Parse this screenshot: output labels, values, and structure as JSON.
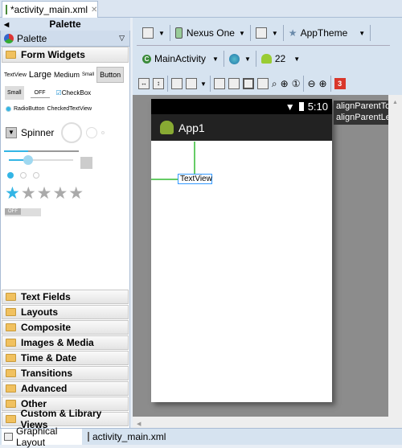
{
  "editor_tab": {
    "title": "*activity_main.xml",
    "close_icon": "close-icon"
  },
  "palette": {
    "header": "Palette",
    "title": "Palette",
    "open_category": "Form Widgets",
    "widgets": {
      "textview": "TextView",
      "large": "Large",
      "medium": "Medium",
      "small": "Small",
      "button": "Button",
      "small_button": "Small",
      "toggle": "OFF",
      "checkbox": "CheckBox",
      "radio": "RadioButton",
      "checked_text": "CheckedTextView",
      "spinner": "Spinner",
      "switch": "OFF"
    },
    "rating_stars": 5,
    "rating_value": 1,
    "categories": [
      "Text Fields",
      "Layouts",
      "Composite",
      "Images & Media",
      "Time & Date",
      "Transitions",
      "Advanced",
      "Other",
      "Custom & Library Views"
    ]
  },
  "toolbar": {
    "device": "Nexus One",
    "theme": "AppTheme",
    "activity": "MainActivity",
    "api": "22",
    "issues": "3"
  },
  "device_preview": {
    "time": "5:10",
    "app_title": "App1",
    "textview": "TextView",
    "tooltip": [
      "alignParentTop",
      "alignParentLeft"
    ]
  },
  "bottom_tabs": [
    "Graphical Layout",
    "activity_main.xml"
  ],
  "colors": {
    "accent": "#33b5e5",
    "issue_badge": "#d9372b"
  }
}
